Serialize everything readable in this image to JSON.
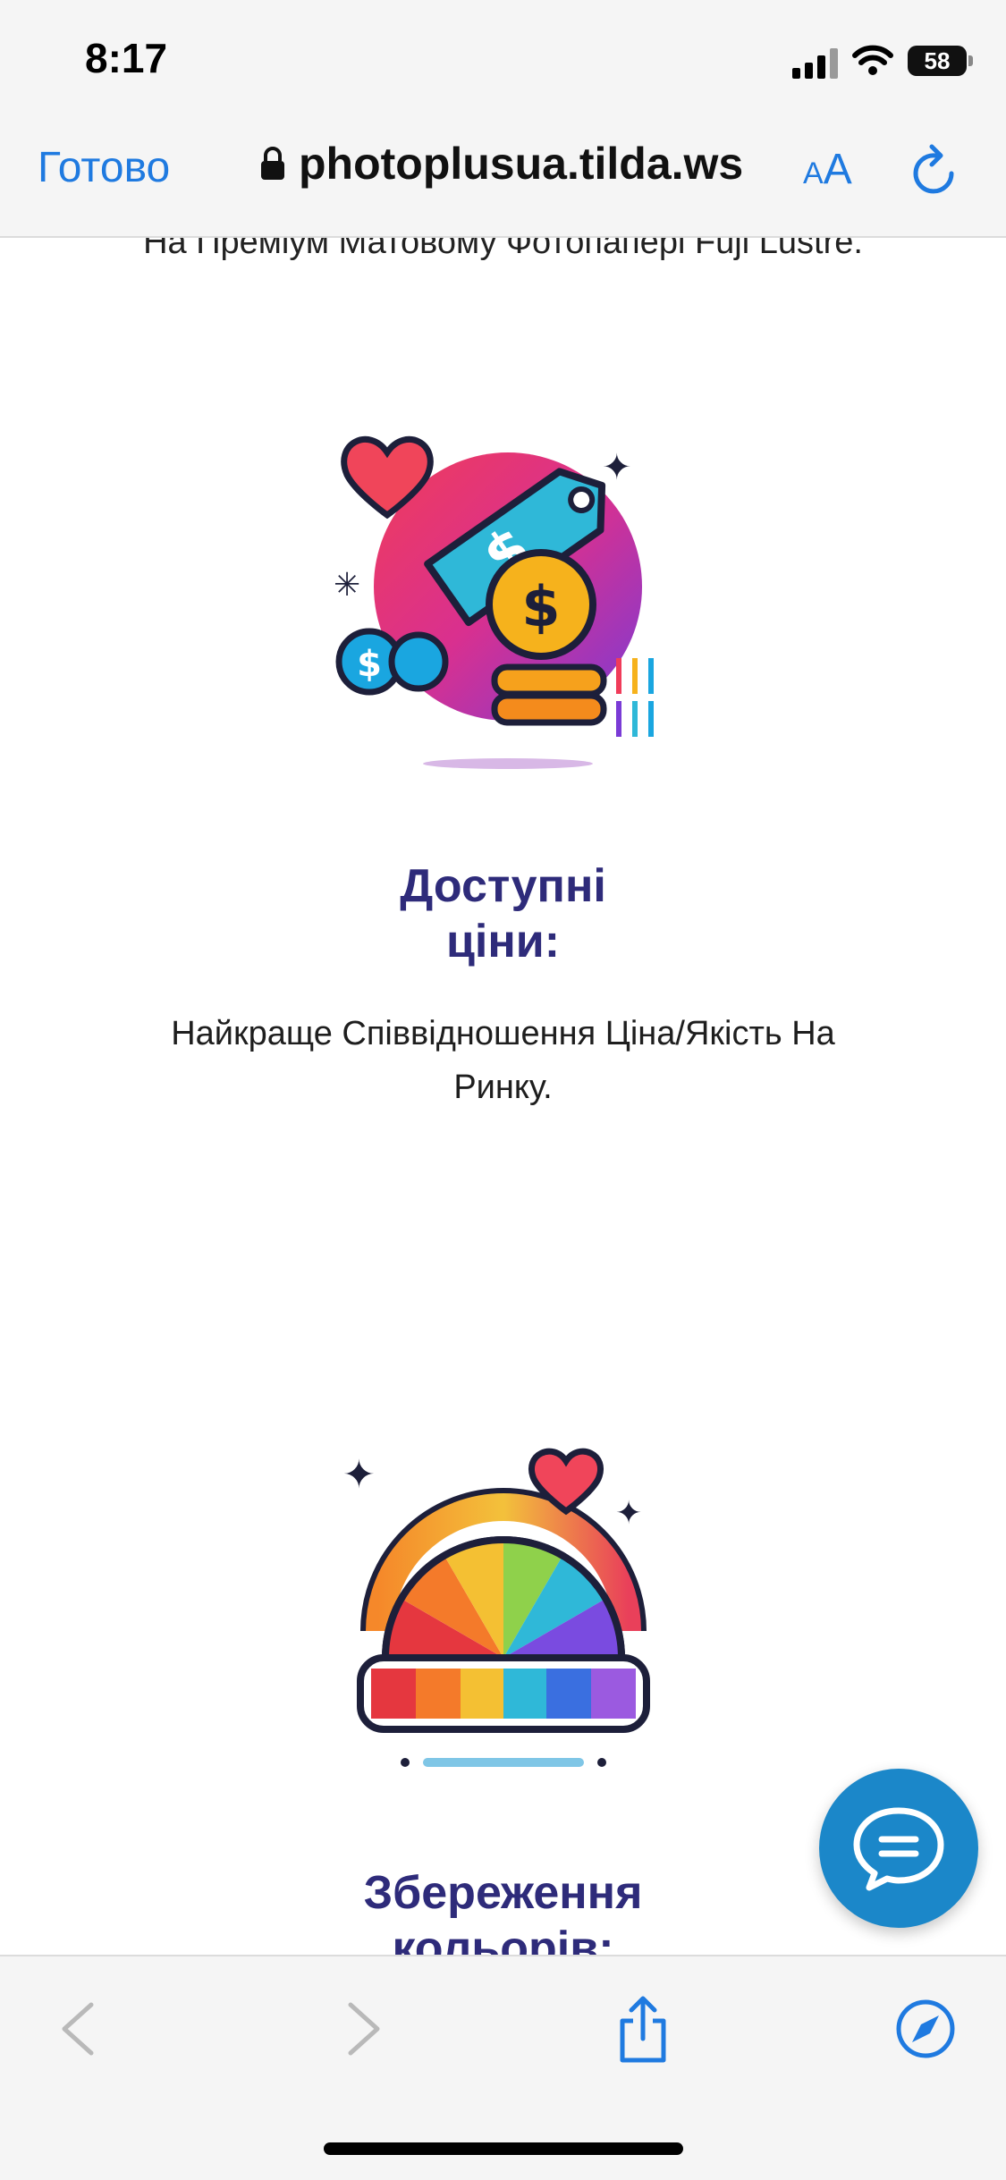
{
  "status_bar": {
    "time": "8:17",
    "battery": "58"
  },
  "browser": {
    "done_label": "Готово",
    "url": "photoplusua.tilda.ws",
    "aa_small": "A",
    "aa_large": "A"
  },
  "content": {
    "cut_text": "На Преміум Матовому Фотопапері Fuji Lustre.",
    "features": [
      {
        "title_line1": "Доступні",
        "title_line2": "ціни:",
        "text_line1": "Найкраще Співвідношення Ціна/Якість На",
        "text_line2": "Ринку.",
        "icon": "price-tag-icon"
      },
      {
        "title_line1": "Збереження",
        "title_line2": "кольорів:",
        "icon": "color-palette-icon"
      }
    ]
  },
  "icons": {
    "chat": "chat-bubble-icon",
    "back": "chevron-left-icon",
    "forward": "chevron-right-icon",
    "share": "share-icon",
    "safari": "compass-icon"
  },
  "colors": {
    "accent": "#1f7ae0",
    "title": "#2e2b7a",
    "chat_button": "#1b87c9"
  }
}
